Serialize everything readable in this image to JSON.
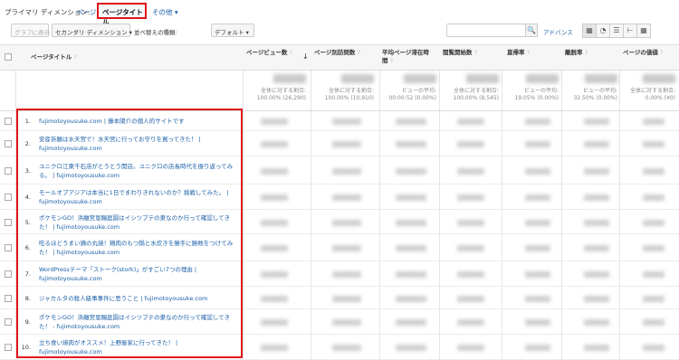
{
  "dimensions": {
    "label": "プライマリ ディメンション:",
    "page": "ページ",
    "page_title": "ページタイトル",
    "other": "その他 ▾"
  },
  "toolbar": {
    "plot_rows": "グラフに表示",
    "secondary_dimension": "セカンダリ ディメンション ▾",
    "sort_type": "並べ替えの種類:",
    "sort_default": "デフォルト ▾",
    "search_placeholder": "",
    "advanced": "アドバンス"
  },
  "table": {
    "headers": {
      "page_title": "ページタイトル",
      "pageviews": "ページビュー数",
      "unique_pageviews": "ページ別訪問数",
      "avg_time": "平均ページ滞在時間",
      "entrances": "閲覧開始数",
      "bounce_rate": "直帰率",
      "exit_rate": "離脱率",
      "page_value": "ページの価値"
    },
    "totals": [
      {
        "l1": "全体に対する割合:",
        "l2": "100.00% (26,290)"
      },
      {
        "l1": "全体に対する割合:",
        "l2": "100.00% (10,910)"
      },
      {
        "l1": "ビューの平均:",
        "l2": "00:00:52 (0.00%)"
      },
      {
        "l1": "全体に対する割合:",
        "l2": "100.00% (8,545)"
      },
      {
        "l1": "ビューの平均:",
        "l2": "19.05% (0.00%)"
      },
      {
        "l1": "ビューの平均:",
        "l2": "32.50% (0.00%)"
      },
      {
        "l1": "全体に対する割合:",
        "l2": "0.00% (¥0)"
      }
    ],
    "rows": [
      {
        "idx": "1.",
        "title": "fujimotoyousuke.com | 藤本陽介の個人的サイトです"
      },
      {
        "idx": "2.",
        "title": "安産祈願は水天宮で！水天宮に行ってお守りを買ってきた！ | fujimotoyousuke.com"
      },
      {
        "idx": "3.",
        "title": "ユニクロ江東千石店がとうとう開店。ユニクロの店長時代を振り返ってみる。 | fujimotoyousuke.com"
      },
      {
        "idx": "4.",
        "title": "モールオブアジアは本当に1日でまわりきれないのか？挑戦してみた。 | fujimotoyousuke.com"
      },
      {
        "idx": "5.",
        "title": "ポケモンGO！浜離宮恩賜庭園はイシツブテの巣なのか行って確認してきた！ | fujimotoyousuke.com"
      },
      {
        "idx": "6.",
        "title": "吃るほどうまい鶏の丸焼！鶏肉のもつ鍋と水炊きを勝手に勝敗をつけてみた！ | fujimotoyousuke.com"
      },
      {
        "idx": "7.",
        "title": "WordPressテーマ「ストーク(stork)」がすごい7つの理由 | fujimotoyousuke.com"
      },
      {
        "idx": "8.",
        "title": "ジャカルタの殺人級事事件に思うこと | fujimotoyousuke.com"
      },
      {
        "idx": "9.",
        "title": "ポケモンGO！浜離宮恩賜庭園はイシツブテの巣なのか行って確認してきた！ - fujimotoyousuke.com"
      },
      {
        "idx": "10.",
        "title": "立ち食い焼肉がオススメ！上野屋家に行ってきた！ | fujimotoyousuke.com"
      }
    ]
  }
}
